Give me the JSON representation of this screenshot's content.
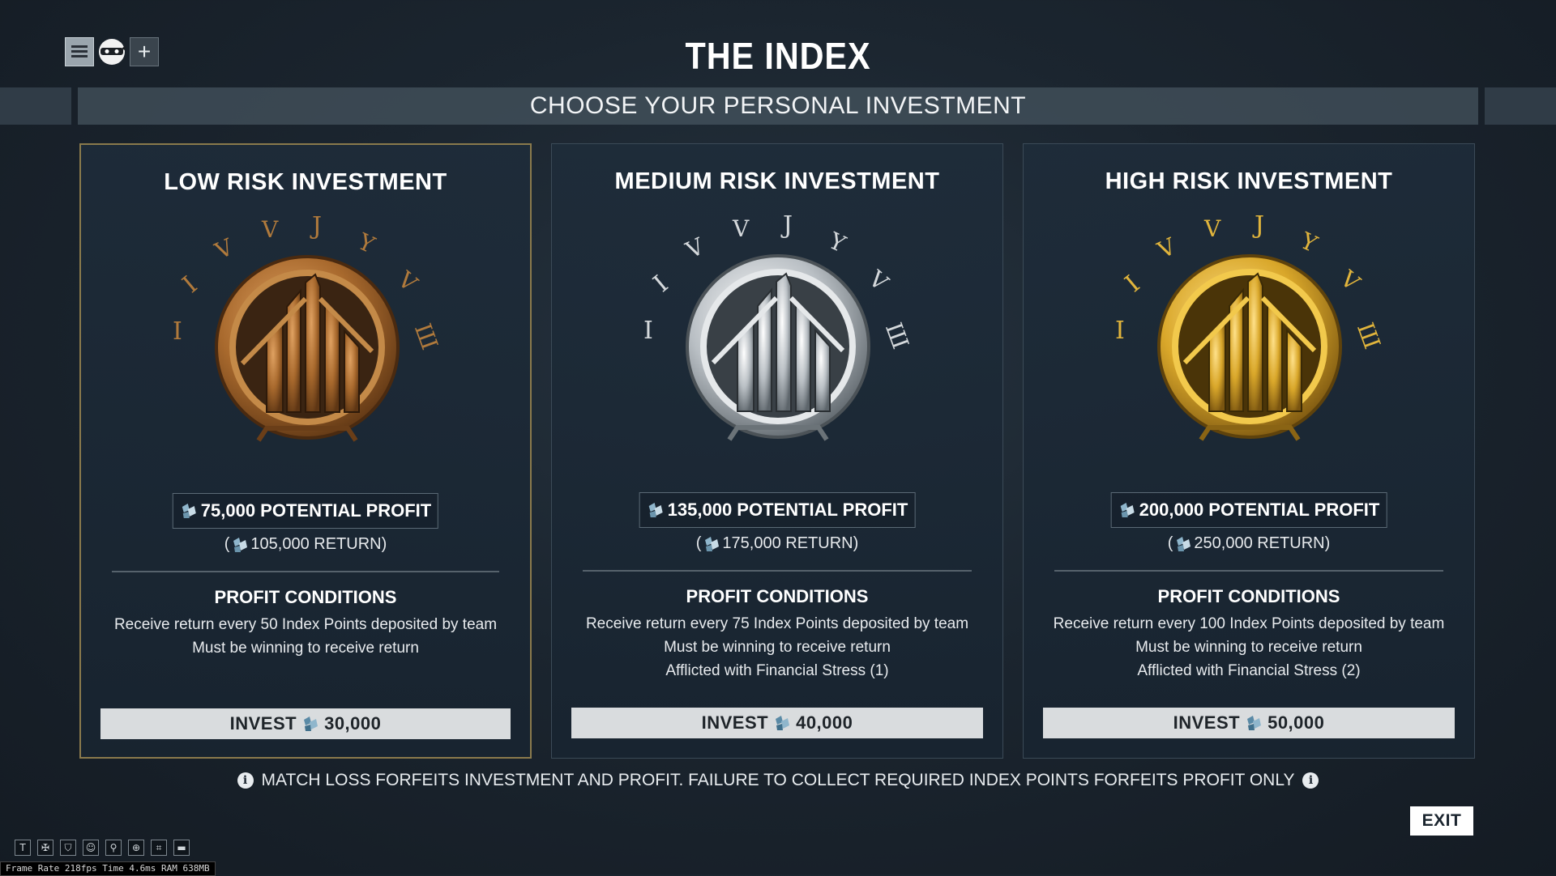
{
  "header": {
    "title": "THE INDEX",
    "subtitle": "CHOOSE YOUR PERSONAL INVESTMENT"
  },
  "top_left_icons": [
    "menu-icon",
    "ninja-avatar-icon",
    "plus-icon"
  ],
  "currency_icon": "platinum-icon",
  "colors": {
    "bronze": "#b07a3c",
    "silver": "#c9ced2",
    "gold": "#d9a72a",
    "selected_border": "#8a7a4c",
    "button_bg": "#d9dcde"
  },
  "cards": [
    {
      "title": "LOW RISK INVESTMENT",
      "profit": "75,000 POTENTIAL PROFIT",
      "return_open": "(",
      "return_value": "105,000 RETURN)",
      "conditions_title": "PROFIT CONDITIONS",
      "conditions": [
        "Receive return every 50 Index Points deposited by team",
        "Must be winning to receive return"
      ],
      "invest_label": "INVEST",
      "invest_amount": "30,000",
      "tier": "bronze"
    },
    {
      "title": "MEDIUM RISK INVESTMENT",
      "profit": "135,000 POTENTIAL PROFIT",
      "return_open": "(",
      "return_value": "175,000 RETURN)",
      "conditions_title": "PROFIT CONDITIONS",
      "conditions": [
        "Receive return every 75 Index Points deposited by team",
        "Must be winning to receive return",
        "Afflicted with Financial Stress (1)"
      ],
      "invest_label": "INVEST",
      "invest_amount": "40,000",
      "tier": "silver"
    },
    {
      "title": "HIGH RISK INVESTMENT",
      "profit": "200,000 POTENTIAL PROFIT",
      "return_open": "(",
      "return_value": "250,000 RETURN)",
      "conditions_title": "PROFIT CONDITIONS",
      "conditions": [
        "Receive return every 100 Index Points deposited by team",
        "Must be winning to receive return",
        "Afflicted with Financial Stress (2)"
      ],
      "invest_label": "INVEST",
      "invest_amount": "50,000",
      "tier": "gold"
    }
  ],
  "footer_note": "MATCH LOSS FORFEITS INVESTMENT AND PROFIT. FAILURE TO COLLECT REQUIRED INDEX POINTS FORFEITS PROFIT ONLY",
  "exit_label": "EXIT",
  "bottom_icons": [
    {
      "name": "text-icon",
      "glyph": "T"
    },
    {
      "name": "wings-icon",
      "glyph": "✠"
    },
    {
      "name": "shield-icon",
      "glyph": "⛉"
    },
    {
      "name": "face-icon",
      "glyph": "☺"
    },
    {
      "name": "pin-icon",
      "glyph": "⚲"
    },
    {
      "name": "zoom-icon",
      "glyph": "⊕"
    },
    {
      "name": "bracket-icon",
      "glyph": "⌗"
    },
    {
      "name": "minus-box-icon",
      "glyph": "▬"
    }
  ],
  "debug": {
    "frame_rate_text": "Frame Rate 218fps Time 4.6ms RAM 638MB"
  }
}
